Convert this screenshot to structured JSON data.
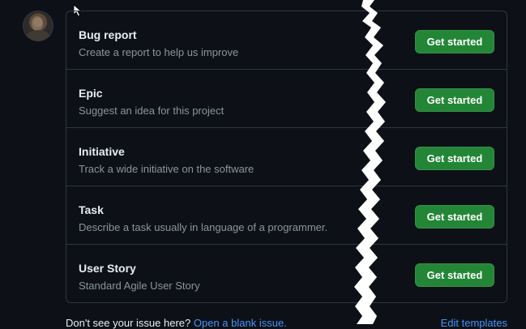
{
  "templates": [
    {
      "title": "Bug report",
      "description": "Create a report to help us improve",
      "button": "Get started"
    },
    {
      "title": "Epic",
      "description": "Suggest an idea for this project",
      "button": "Get started"
    },
    {
      "title": "Initiative",
      "description": "Track a wide initiative on the software",
      "button": "Get started"
    },
    {
      "title": "Task",
      "description": "Describe a task usually in language of a programmer.",
      "button": "Get started"
    },
    {
      "title": "User Story",
      "description": "Standard Agile User Story",
      "button": "Get started"
    }
  ],
  "footer": {
    "question": "Don't see your issue here?",
    "blank_issue_link": "Open a blank issue.",
    "edit_templates_link": "Edit templates"
  },
  "colors": {
    "background": "#0d1117",
    "border": "#30363d",
    "primary_button": "#238636",
    "link": "#4493f8",
    "muted_text": "#8b949e"
  }
}
